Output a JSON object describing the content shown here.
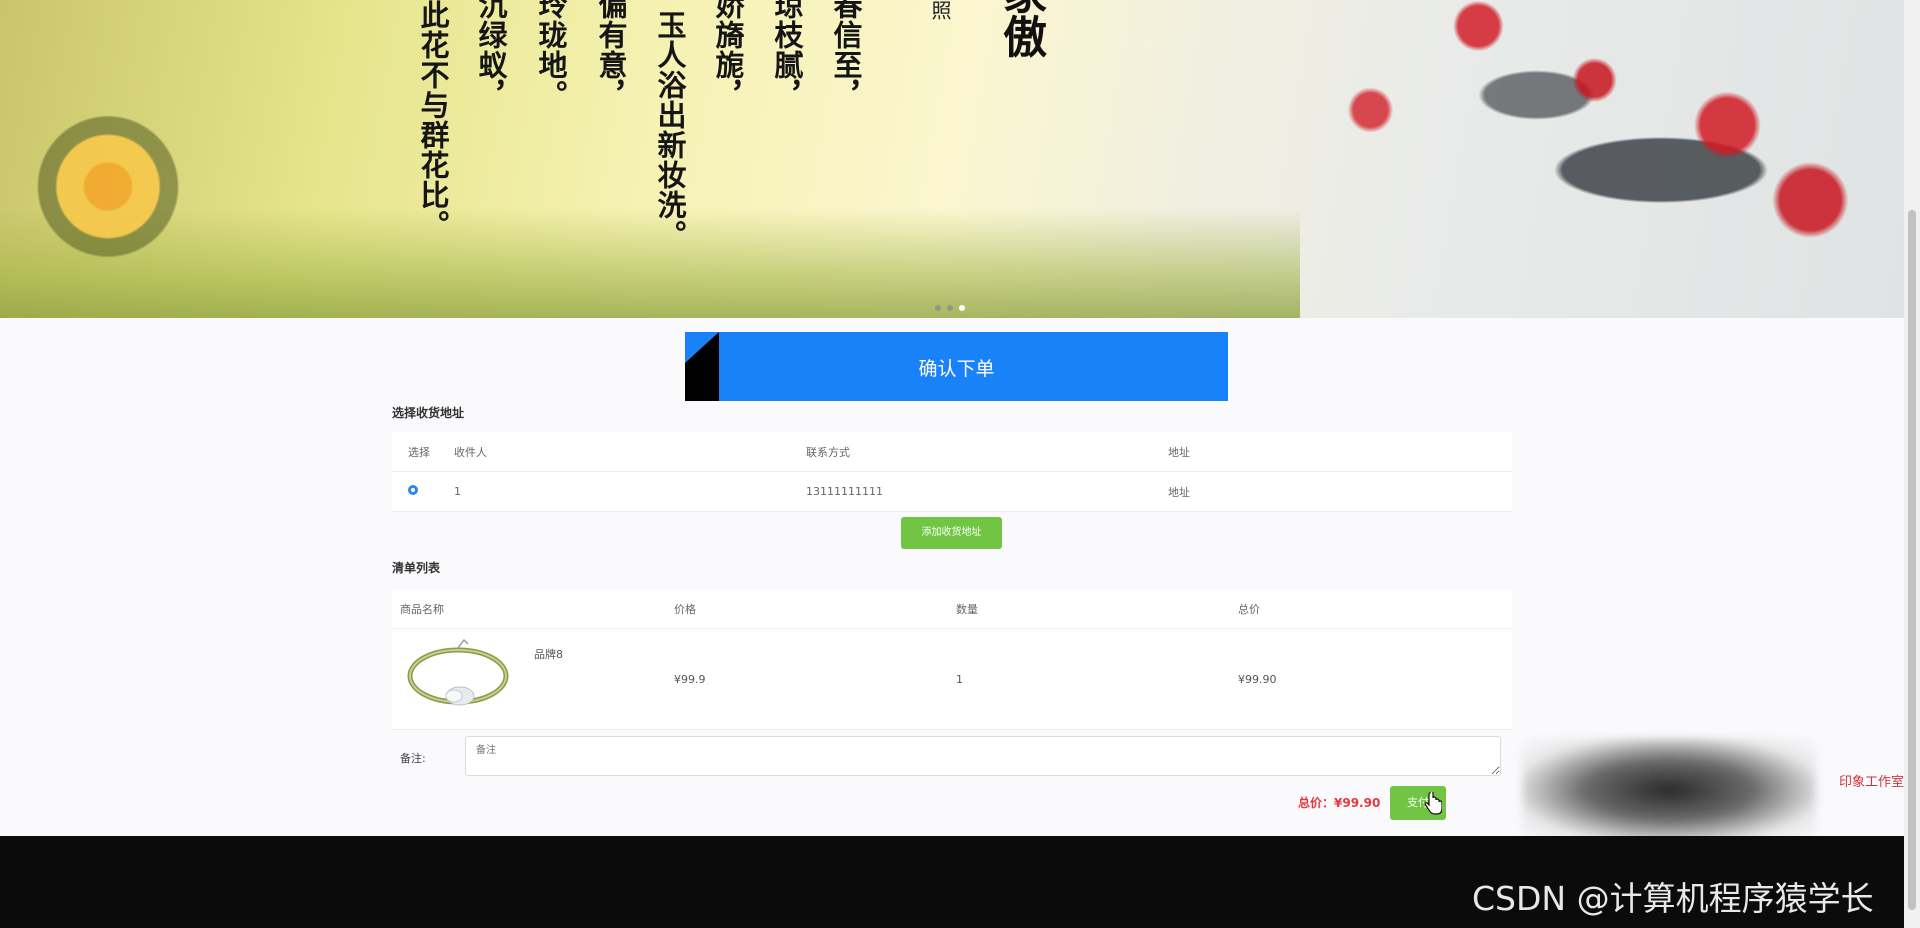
{
  "banner": {
    "poem_title": "家傲",
    "poem_author": "照",
    "poem_lines": [
      "此花不与群花比。",
      "寻沉绿蚁，",
      "为玲珑地。",
      "能偏有意，",
      "玉人浴出新妆洗。",
      "开娇旖旎，",
      "琼琼枝腻，",
      "知春信至，"
    ],
    "carousel_dots": 3,
    "active_dot": 2
  },
  "confirm": {
    "title": "确认下单"
  },
  "address_section": {
    "title": "选择收货地址",
    "columns": [
      "选择",
      "收件人",
      "联系方式",
      "地址"
    ],
    "rows": [
      {
        "recipient": "1",
        "phone": "13111111111",
        "address": "地址"
      }
    ],
    "add_button": "添加收货地址"
  },
  "list_section": {
    "title": "清单列表",
    "columns": [
      "商品名称",
      "价格",
      "数量",
      "总价"
    ],
    "rows": [
      {
        "name": "品牌8",
        "price": "¥99.9",
        "quantity": "1",
        "total": "¥99.90"
      }
    ]
  },
  "remark": {
    "label": "备注:",
    "placeholder": "备注"
  },
  "total": {
    "text": "总价：¥99.90"
  },
  "pay_button": "支付",
  "side_text": "印象工作室",
  "watermark": "CSDN @计算机程序猿学长",
  "colors": {
    "primary": "#1a82f8",
    "green": "#71c542",
    "price_red": "#e4383e"
  }
}
